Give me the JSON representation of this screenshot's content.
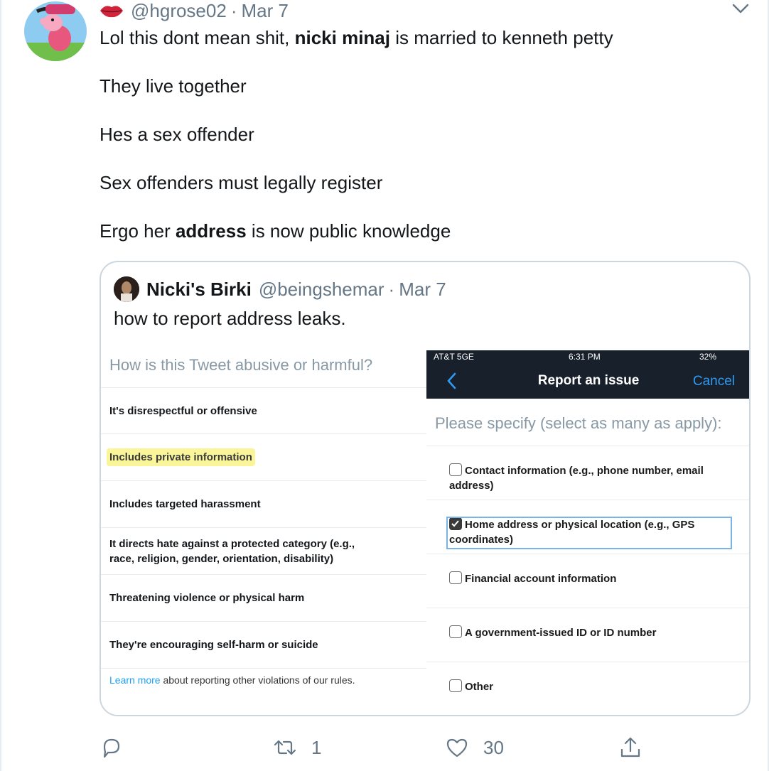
{
  "tweet": {
    "author_icon": "lips-icon",
    "handle": "@hgrose02",
    "separator": "·",
    "date": "Mar 7",
    "line1_a": "Lol this dont mean shit, ",
    "line1_b": "nicki minaj",
    "line1_c": " is married to kenneth petty",
    "line2": "They live together",
    "line3": "Hes a sex offender",
    "line4": "Sex offenders must legally register",
    "line5_a": "Ergo her ",
    "line5_b": "address",
    "line5_c": " is now public knowledge"
  },
  "quote": {
    "name": "Nicki's Birki",
    "handle": "@beingshemar",
    "separator": "·",
    "date": "Mar 7",
    "text": "how to report address leaks."
  },
  "left_shot": {
    "question": "How is this Tweet abusive or harmful?",
    "items": [
      "It's disrespectful or offensive",
      "Includes private information",
      "Includes targeted harassment",
      "It directs hate against a protected category (e.g., race, religion, gender, orientation, disability)",
      "Threatening violence or physical harm",
      "They're encouraging self-harm or suicide"
    ],
    "footer_link": "Learn more",
    "footer_text": " about reporting other violations of our rules."
  },
  "right_shot": {
    "carrier": "AT&T  5GE",
    "time": "6:31 PM",
    "battery": "32%",
    "title": "Report an issue",
    "cancel": "Cancel",
    "prompt": "Please specify (select as many as apply):",
    "options": [
      {
        "label": "Contact information (e.g., phone number, email address)",
        "checked": false
      },
      {
        "label": "Home address or physical location (e.g., GPS coordinates)",
        "checked": true
      },
      {
        "label": "Financial account information",
        "checked": false
      },
      {
        "label": "A government-issued ID or ID number",
        "checked": false
      },
      {
        "label": "Other",
        "checked": false
      }
    ]
  },
  "actions": {
    "reply_count": "",
    "retweet_count": "1",
    "like_count": "30"
  },
  "colors": {
    "secondary_text": "#657786",
    "border": "#ccd6dd",
    "link": "#1da1f2",
    "highlight": "#fbf59a",
    "nav_bg": "#18202b"
  }
}
